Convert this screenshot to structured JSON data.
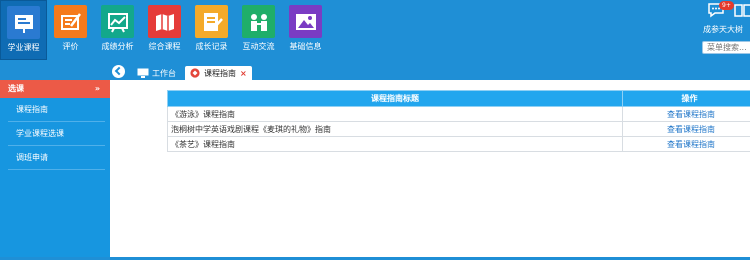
{
  "nav": {
    "items": [
      {
        "label": "学业课程",
        "icon": "board-icon",
        "color": "#2a7ad1"
      },
      {
        "label": "评价",
        "icon": "edit-icon",
        "color": "#f57a1c"
      },
      {
        "label": "成绩分析",
        "icon": "chart-icon",
        "color": "#13a88b"
      },
      {
        "label": "综合课程",
        "icon": "map-icon",
        "color": "#e53b39"
      },
      {
        "label": "成长记录",
        "icon": "notebook-icon",
        "color": "#f4aa2a"
      },
      {
        "label": "互动交流",
        "icon": "people-icon",
        "color": "#1fae6a"
      },
      {
        "label": "基础信息",
        "icon": "image-icon",
        "color": "#7a3cc3"
      }
    ]
  },
  "header": {
    "badge": "9+",
    "user": "成参天大树",
    "menu_search": "菜单搜索..."
  },
  "tabs": {
    "workbench": "工作台",
    "guide": "课程指南",
    "close": "×"
  },
  "sidebar": {
    "section": "选课",
    "chevron": "»",
    "items": [
      {
        "label": "课程指南"
      },
      {
        "label": "学业课程选课"
      },
      {
        "label": "调班申请"
      }
    ]
  },
  "table": {
    "headers": [
      "课程指南标题",
      "操作"
    ],
    "rows": [
      {
        "title": "《游泳》课程指南",
        "action": "查看课程指南"
      },
      {
        "title": "泡桐树中学英语戏剧课程《麦琪的礼物》指南",
        "action": "查看课程指南"
      },
      {
        "title": "《茶艺》课程指南",
        "action": "查看课程指南"
      }
    ]
  },
  "colors": {
    "brand_blue": "#1f8fd6",
    "sidebar_blue": "#1796e0",
    "sidebar_header": "#ec5a47",
    "table_header": "#22a6ee",
    "link": "#1d74c8"
  }
}
